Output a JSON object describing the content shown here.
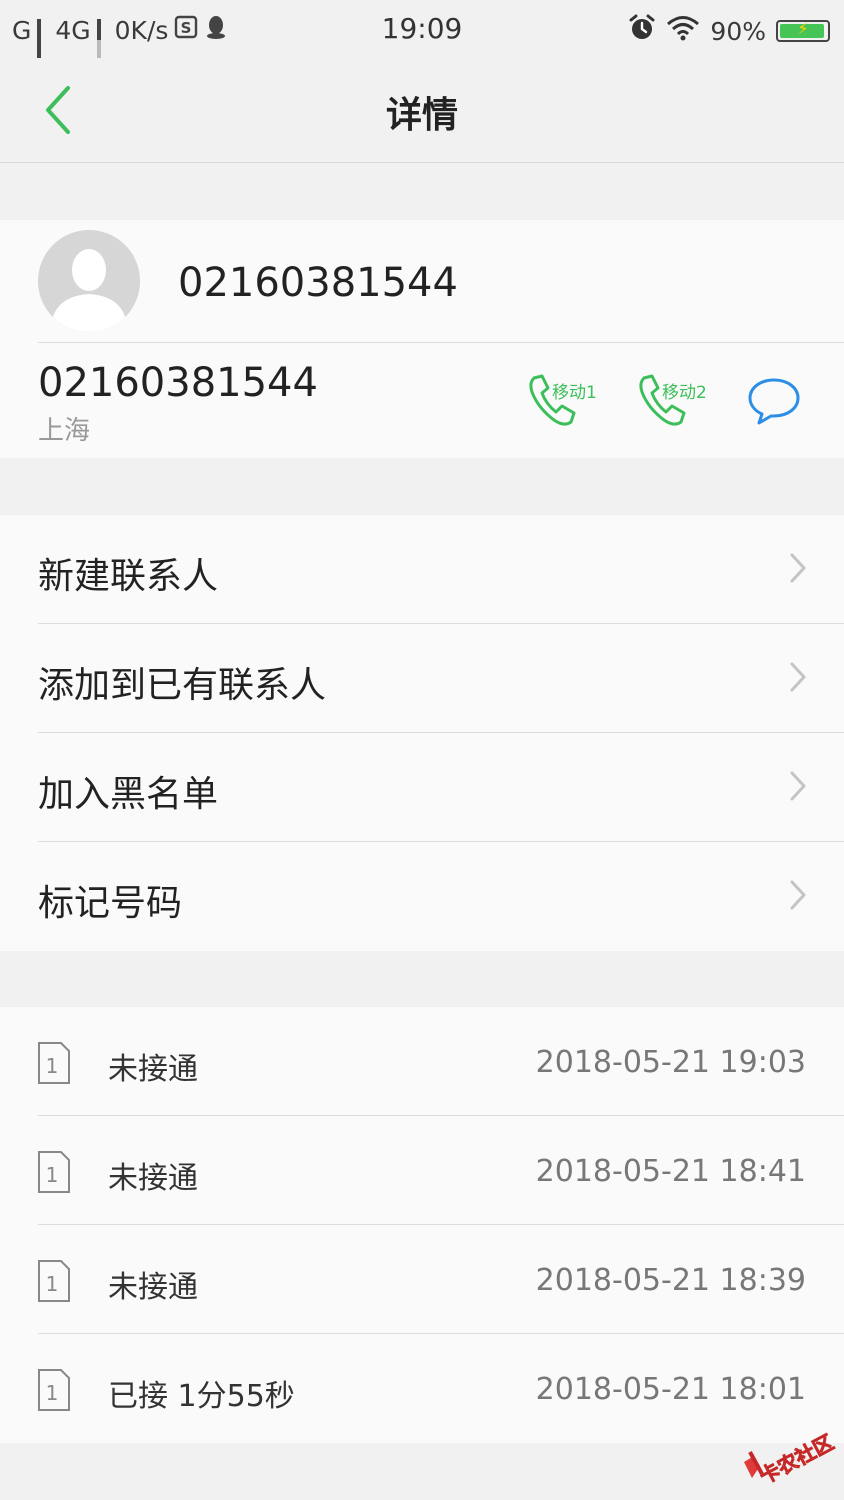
{
  "status_bar": {
    "carrier1": "G",
    "carrier2": "4G",
    "speed": "0K/s",
    "time": "19:09",
    "battery": "90%"
  },
  "nav": {
    "title": "详情"
  },
  "contact": {
    "name": "02160381544",
    "number": "02160381544",
    "location": "上海",
    "call_sim1_label": "移动1",
    "call_sim2_label": "移动2"
  },
  "menu": [
    {
      "label": "新建联系人"
    },
    {
      "label": "添加到已有联系人"
    },
    {
      "label": "加入黑名单"
    },
    {
      "label": "标记号码"
    }
  ],
  "history": [
    {
      "sim": "1",
      "status": "未接通",
      "time": "2018-05-21 19:03"
    },
    {
      "sim": "1",
      "status": "未接通",
      "time": "2018-05-21 18:41"
    },
    {
      "sim": "1",
      "status": "未接通",
      "time": "2018-05-21 18:39"
    },
    {
      "sim": "1",
      "status": "已接 1分55秒",
      "time": "2018-05-21 18:01"
    }
  ],
  "watermark": {
    "text": "卡农社区"
  },
  "colors": {
    "accent_green": "#3cbf5a",
    "message_blue": "#2d8ee6",
    "background": "#f1f1f1",
    "card": "#fafafa"
  }
}
